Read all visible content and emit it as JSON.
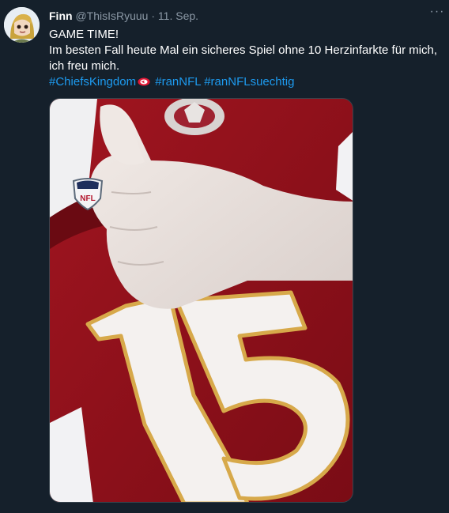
{
  "tweet": {
    "author_name": "Finn",
    "author_handle": "@ThisIsRyuuu",
    "separator": "·",
    "date": "11. Sep.",
    "more_label": "···",
    "line1": "GAME TIME!",
    "line2": "Im besten Fall heute Mal ein sicheres Spiel ohne 10 Herzinfarkte für mich, ich freu mich.",
    "hashtags": [
      "#ChiefsKingdom",
      "#ranNFL",
      "#ranNFLsuechtig"
    ],
    "jersey_number": "15",
    "badge_text": "NFL"
  },
  "colors": {
    "background": "#15202b",
    "text": "#ffffff",
    "secondary_text": "#8b98a5",
    "link": "#1d9bf0",
    "jersey_red": "#a3131f",
    "jersey_gold": "#d7a94a"
  },
  "icons": {
    "more": "more-horizontal-icon",
    "hashtag_emoji": "chiefs-arrowhead-icon"
  }
}
